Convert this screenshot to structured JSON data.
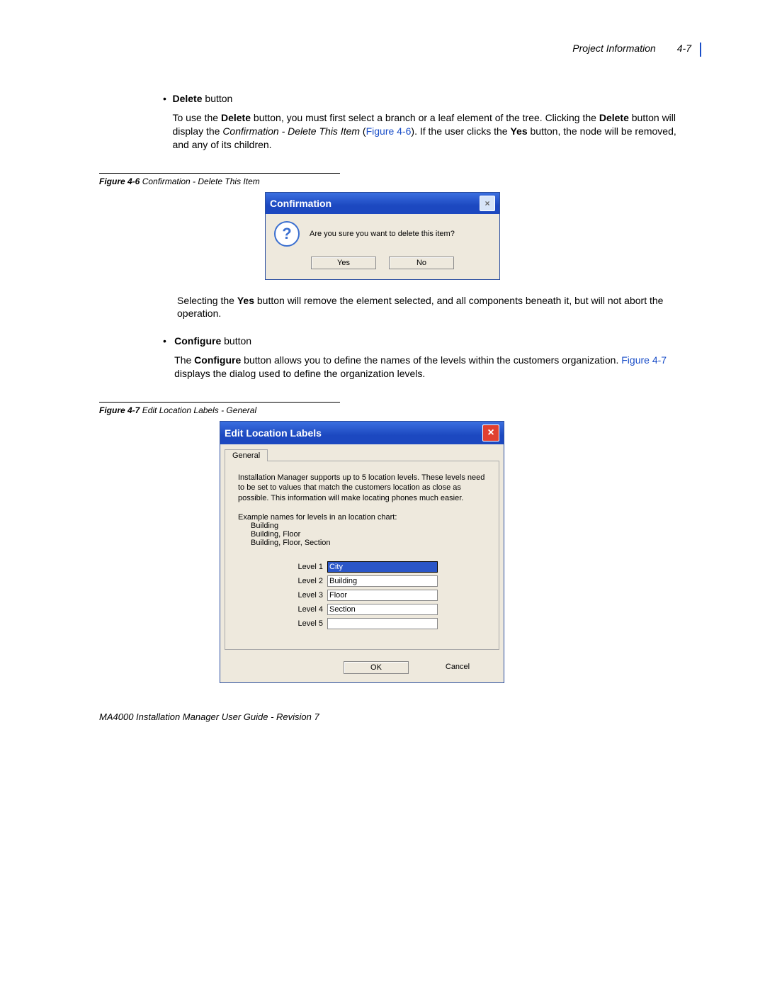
{
  "header": {
    "section": "Project Information",
    "page": "4-7"
  },
  "bullets": {
    "delete": {
      "title_strong": "Delete",
      "title_rest": " button",
      "p1a": "To use the ",
      "p1b": "Delete",
      "p1c": " button, you must first select a branch or a leaf element of the tree. Clicking the ",
      "p1d": "Delete",
      "p1e": " button will display the ",
      "p1f": "Confirmation - Delete This Item",
      "p1g": " (",
      "p1h": "Figure 4-6",
      "p1i": "). If the user clicks the ",
      "p1j": "Yes",
      "p1k": " button, the node will be removed, and any of its children.",
      "p2a": "Selecting the ",
      "p2b": "Yes",
      "p2c": " button will remove the element selected, and all components beneath it, but will not abort the operation."
    },
    "configure": {
      "title_strong": "Configure",
      "title_rest": " button",
      "p1a": "The ",
      "p1b": "Configure",
      "p1c": " button allows you to define the names of the levels within the customers organization. ",
      "p1d": "Figure 4-7",
      "p1e": " displays the dialog used to define the organization levels."
    }
  },
  "fig6": {
    "label": "Figure 4-6",
    "caption": "  Confirmation - Delete This Item",
    "title": "Confirmation",
    "message": "Are you sure you want to delete this item?",
    "yes": "Yes",
    "no": "No"
  },
  "fig7": {
    "label": "Figure 4-7",
    "caption": "  Edit Location Labels - General",
    "title": "Edit Location Labels",
    "tab": "General",
    "desc": "Installation Manager supports up to 5 location levels. These levels need to be set to values that match the customers location as close as possible. This information will make locating phones much easier.",
    "examples_intro": "Example names for levels in an location chart:",
    "ex1": "Building",
    "ex2": "Building, Floor",
    "ex3": "Building, Floor, Section",
    "levels": {
      "l1_label": "Level 1",
      "l1_value": "City",
      "l2_label": "Level 2",
      "l2_value": "Building",
      "l3_label": "Level 3",
      "l3_value": "Floor",
      "l4_label": "Level 4",
      "l4_value": "Section",
      "l5_label": "Level 5",
      "l5_value": ""
    },
    "ok": "OK",
    "cancel": "Cancel"
  },
  "footer": "MA4000 Installation Manager User Guide - Revision 7"
}
